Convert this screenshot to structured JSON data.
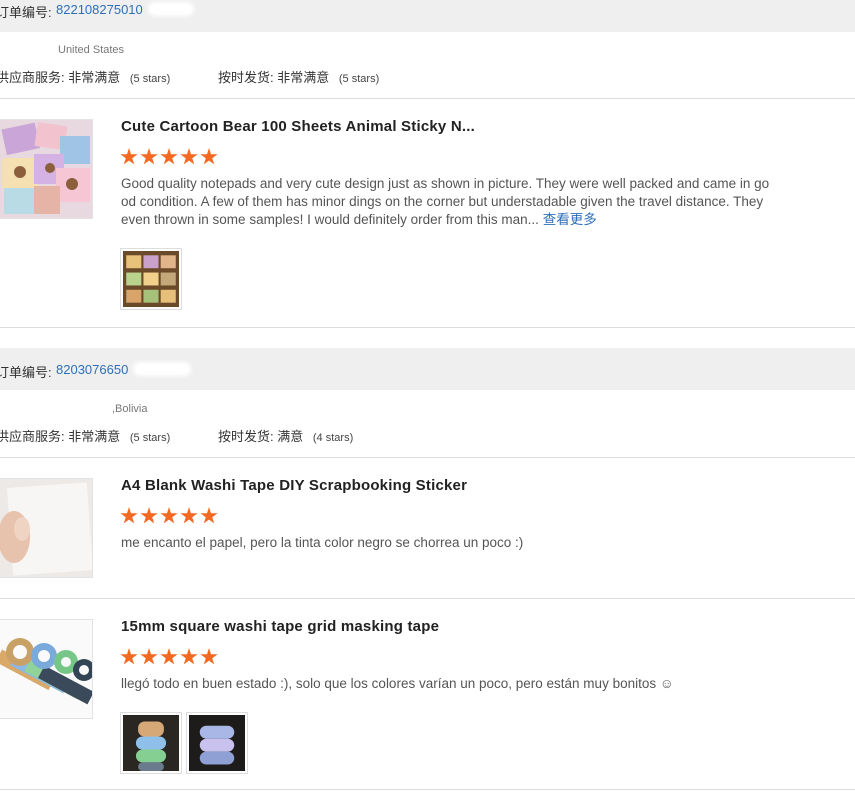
{
  "orders": [
    {
      "order_label": "订单编号:",
      "order_number": "822108275010",
      "buyer_country": "United States",
      "supplier_service_label": "供应商服务:",
      "supplier_service_value": "非常满意",
      "supplier_service_stars": "(5 stars)",
      "shipping_label": "按时发货:",
      "shipping_value": "非常满意",
      "shipping_stars": "(5 stars)",
      "items": [
        {
          "title": "Cute Cartoon Bear 100 Sheets Animal Sticky N...",
          "rating": 5,
          "review": "Good quality notepads and very cute design just as shown in picture. They were well packed and came in good condition. A few of them has minor dings on the corner but understadable given the travel distance. They even thrown in some samples! I would definitely order from this man...",
          "more_label": "查看更多",
          "photos": [
            "notepad-photo"
          ]
        }
      ]
    },
    {
      "order_label": "订单编号:",
      "order_number": "8203076650",
      "buyer_country": ",Bolivia",
      "supplier_service_label": "供应商服务:",
      "supplier_service_value": "非常满意",
      "supplier_service_stars": "(5 stars)",
      "shipping_label": "按时发货:",
      "shipping_value": "满意",
      "shipping_stars": "(4 stars)",
      "items": [
        {
          "title": "A4 Blank Washi Tape DIY Scrapbooking Sticker",
          "rating": 5,
          "review": "me encanto el papel, pero la tinta color negro se chorrea un poco :)",
          "photos": []
        },
        {
          "title": "15mm square washi tape grid masking tape",
          "rating": 5,
          "review": "llegó todo en buen estado :), solo que los colores varían un poco, pero están muy bonitos ☺",
          "photos": [
            "tape-photo-1",
            "tape-photo-2"
          ]
        }
      ]
    }
  ],
  "colors": {
    "star": "#f26a22",
    "link": "#2f6fb8",
    "header_bg": "#efefef"
  }
}
